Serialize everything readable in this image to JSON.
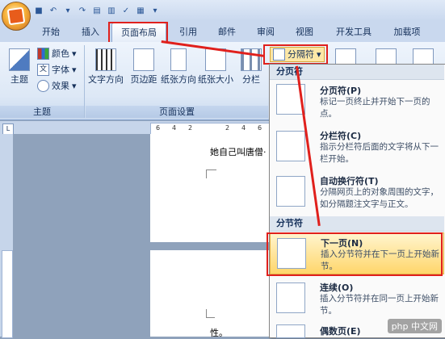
{
  "tabs": [
    "开始",
    "插入",
    "页面布局",
    "引用",
    "邮件",
    "审阅",
    "视图",
    "开发工具",
    "加载项"
  ],
  "ribbon": {
    "theme_group": {
      "label": "主题",
      "theme_button": "主题",
      "colors": "颜色",
      "fonts": "字体",
      "effects": "效果"
    },
    "page_setup_group": {
      "label": "页面设置",
      "text_direction": "文字方向",
      "margins": "页边距",
      "orientation": "纸张方向",
      "size": "纸张大小",
      "columns": "分栏",
      "breaks_button": "分隔符"
    }
  },
  "ruler": {
    "ticks": [
      "6",
      "4",
      "2",
      "2",
      "4",
      "6"
    ],
    "corner": "L"
  },
  "document": {
    "line1": "她自己叫唐僧·",
    "line2": "性。"
  },
  "menu": {
    "section_page": "分页符",
    "section_section": "分节符",
    "items": [
      {
        "title": "分页符(P)",
        "desc": "标记一页终止并开始下一页的点。"
      },
      {
        "title": "分栏符(C)",
        "desc": "指示分栏符后面的文字将从下一栏开始。"
      },
      {
        "title": "自动换行符(T)",
        "desc": "分隔网页上的对象周围的文字，如分隔题注文字与正文。"
      },
      {
        "title": "下一页(N)",
        "desc": "插入分节符并在下一页上开始新节。"
      },
      {
        "title": "连续(O)",
        "desc": "插入分节符并在同一页上开始新节。"
      },
      {
        "title": "偶数页(E)",
        "desc": ""
      }
    ]
  },
  "watermark": "php 中文网",
  "colors": {
    "highlight_red": "#e0201c",
    "menu_hover": "#ffd66b"
  }
}
